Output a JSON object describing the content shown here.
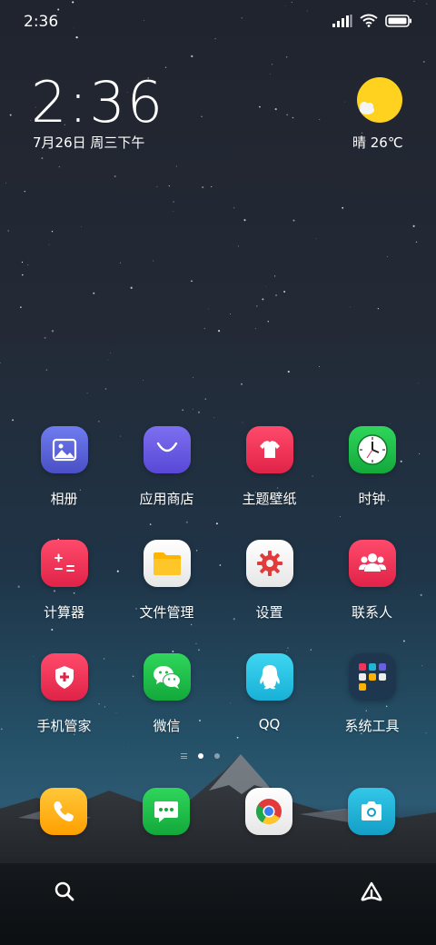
{
  "status_bar": {
    "time": "2:36",
    "signal_icon": "signal-bars-icon",
    "wifi_icon": "wifi-icon",
    "battery_icon": "battery-icon"
  },
  "clock_widget": {
    "time": "2:36",
    "date": "7月26日 周三下午"
  },
  "weather": {
    "text": "晴 26℃",
    "icon": "sunny-cloud-icon"
  },
  "apps": [
    {
      "label": "相册",
      "icon": "gallery-icon"
    },
    {
      "label": "应用商店",
      "icon": "app-store-icon"
    },
    {
      "label": "主题壁纸",
      "icon": "themes-icon"
    },
    {
      "label": "时钟",
      "icon": "clock-icon"
    },
    {
      "label": "计算器",
      "icon": "calculator-icon"
    },
    {
      "label": "文件管理",
      "icon": "folder-icon"
    },
    {
      "label": "设置",
      "icon": "gear-icon"
    },
    {
      "label": "联系人",
      "icon": "contacts-icon"
    },
    {
      "label": "手机管家",
      "icon": "security-shield-icon"
    },
    {
      "label": "微信",
      "icon": "wechat-icon"
    },
    {
      "label": "QQ",
      "icon": "qq-penguin-icon"
    },
    {
      "label": "系统工具",
      "icon": "folder-group-icon"
    }
  ],
  "dock": [
    {
      "icon": "phone-icon"
    },
    {
      "icon": "messages-icon"
    },
    {
      "icon": "chrome-icon"
    },
    {
      "icon": "camera-icon"
    }
  ],
  "page_indicator": {
    "current": 1,
    "total": 2
  },
  "bottom_bar": {
    "left_icon": "search-icon",
    "right_icon": "assistant-icon"
  },
  "colors": {
    "gallery": "#5a63d6",
    "app_store": "#6a5fe0",
    "themes": "#f0345a",
    "clock": "#21c24a",
    "calculator": "#f0345a",
    "settings": "#e23b3b",
    "contacts": "#f0345a",
    "security": "#f0345a",
    "wechat": "#21c24a",
    "qq": "#27c3e6",
    "phone": "#ffb300",
    "messages": "#21c24a",
    "camera": "#1fb6d8",
    "weather_sun": "#ffd21f"
  }
}
